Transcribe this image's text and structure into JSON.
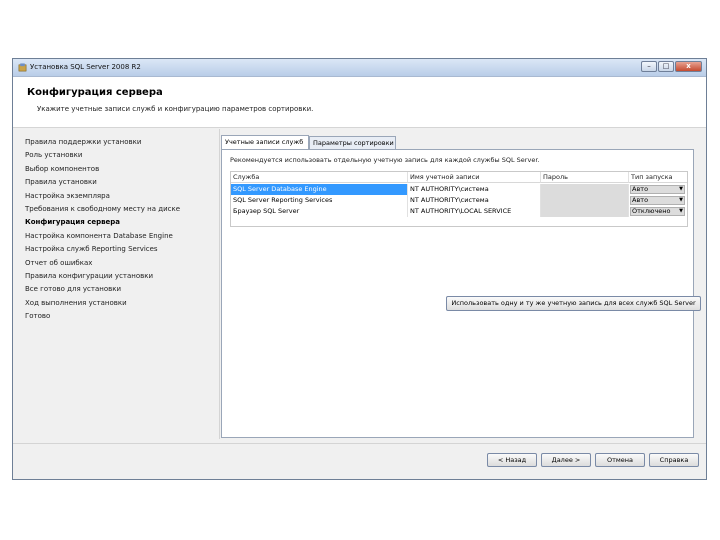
{
  "window": {
    "title": "Установка SQL Server 2008 R2",
    "controls": {
      "minimize": "–",
      "maximize": "□",
      "close": "x"
    }
  },
  "header": {
    "title": "Конфигурация сервера",
    "subtitle": "Укажите учетные записи служб и конфигурацию параметров сортировки."
  },
  "sidebar": {
    "items": [
      {
        "label": "Правила поддержки установки",
        "active": false
      },
      {
        "label": "Роль установки",
        "active": false
      },
      {
        "label": "Выбор компонентов",
        "active": false
      },
      {
        "label": "Правила установки",
        "active": false
      },
      {
        "label": "Настройка экземпляра",
        "active": false
      },
      {
        "label": "Требования к свободному месту на диске",
        "active": false
      },
      {
        "label": "Конфигурация сервера",
        "active": true
      },
      {
        "label": "Настройка компонента Database Engine",
        "active": false
      },
      {
        "label": "Настройка служб Reporting Services",
        "active": false
      },
      {
        "label": "Отчет об ошибках",
        "active": false
      },
      {
        "label": "Правила конфигурации установки",
        "active": false
      },
      {
        "label": "Все готово для установки",
        "active": false
      },
      {
        "label": "Ход выполнения установки",
        "active": false
      },
      {
        "label": "Готово",
        "active": false
      }
    ]
  },
  "tabs": [
    {
      "label": "Учетные записи служб",
      "active": true
    },
    {
      "label": "Параметры сортировки",
      "active": false
    }
  ],
  "panel": {
    "recommendation": "Рекомендуется использовать отдельную учетную запись для каждой службы SQL Server.",
    "table": {
      "columns": [
        "Служба",
        "Имя учетной записи",
        "Пароль",
        "Тип запуска"
      ],
      "rows": [
        {
          "service": "SQL Server Database Engine",
          "account": "NT AUTHORITY\\система",
          "password": "",
          "startup": "Авто",
          "selected": true
        },
        {
          "service": "SQL Server Reporting Services",
          "account": "NT AUTHORITY\\система",
          "password": "",
          "startup": "Авто",
          "selected": false
        },
        {
          "service": "Браузер SQL Server",
          "account": "NT AUTHORITY\\LOCAL SERVICE",
          "password": "",
          "startup": "Отключено",
          "selected": false
        }
      ]
    },
    "use_same_button": "Использовать одну и ту же учетную запись для всех служб SQL Server"
  },
  "footer": {
    "back": "< Назад",
    "next": "Далее >",
    "cancel": "Отмена",
    "help": "Справка"
  },
  "colors": {
    "selection": "#3399ff",
    "titlebar": "#b9cde8"
  }
}
